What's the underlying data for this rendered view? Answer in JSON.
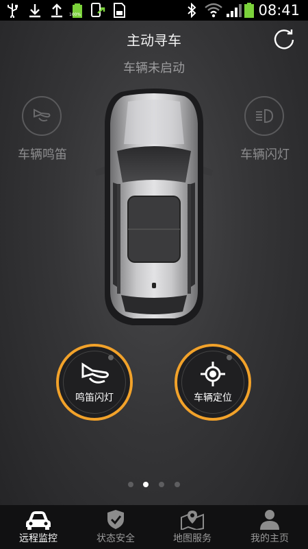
{
  "status_bar": {
    "time": "08:41",
    "battery_small": "100%"
  },
  "header": {
    "title": "主动寻车",
    "subtitle": "车辆未启动"
  },
  "side_buttons": {
    "horn_label": "车辆鸣笛",
    "flash_label": "车辆闪灯"
  },
  "actions": {
    "horn_flash_label": "鸣笛闪灯",
    "locate_label": "车辆定位"
  },
  "pager": {
    "count": 4,
    "active_index": 1
  },
  "tabs": [
    {
      "label": "远程监控",
      "icon": "car-icon",
      "active": true
    },
    {
      "label": "状态安全",
      "icon": "shield-icon",
      "active": false
    },
    {
      "label": "地图服务",
      "icon": "map-pin-icon",
      "active": false
    },
    {
      "label": "我的主页",
      "icon": "user-icon",
      "active": false
    }
  ],
  "colors": {
    "accent": "#f2a22a",
    "background": "#353537",
    "tabbar": "#111112"
  }
}
